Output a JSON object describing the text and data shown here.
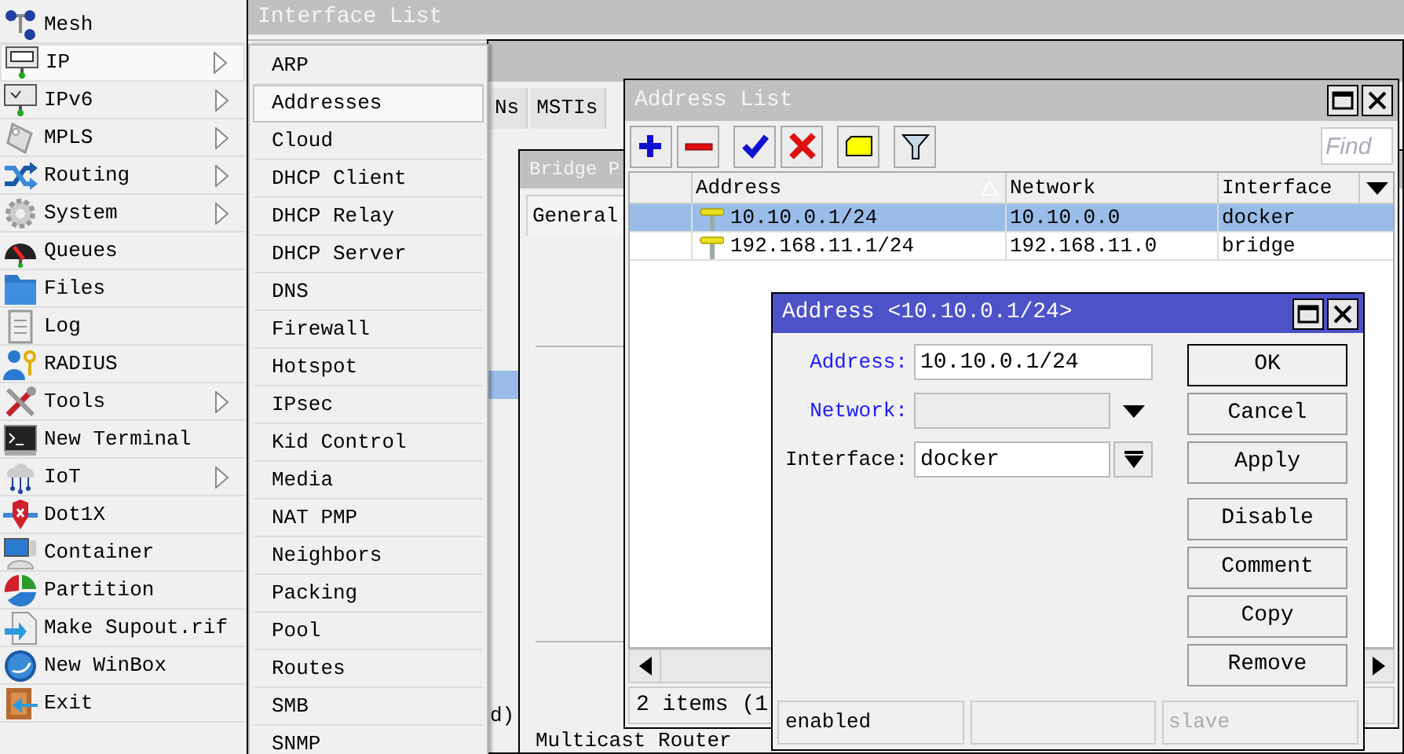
{
  "main_menu": {
    "items": [
      {
        "label": "Mesh",
        "has_submenu": false,
        "selected": false
      },
      {
        "label": "IP",
        "has_submenu": true,
        "selected": true
      },
      {
        "label": "IPv6",
        "has_submenu": true,
        "selected": false
      },
      {
        "label": "MPLS",
        "has_submenu": true,
        "selected": false
      },
      {
        "label": "Routing",
        "has_submenu": true,
        "selected": false
      },
      {
        "label": "System",
        "has_submenu": true,
        "selected": false
      },
      {
        "label": "Queues",
        "has_submenu": false,
        "selected": false
      },
      {
        "label": "Files",
        "has_submenu": false,
        "selected": false
      },
      {
        "label": "Log",
        "has_submenu": false,
        "selected": false
      },
      {
        "label": "RADIUS",
        "has_submenu": false,
        "selected": false
      },
      {
        "label": "Tools",
        "has_submenu": true,
        "selected": false
      },
      {
        "label": "New Terminal",
        "has_submenu": false,
        "selected": false
      },
      {
        "label": "IoT",
        "has_submenu": true,
        "selected": false
      },
      {
        "label": "Dot1X",
        "has_submenu": false,
        "selected": false
      },
      {
        "label": "Container",
        "has_submenu": false,
        "selected": false
      },
      {
        "label": "Partition",
        "has_submenu": false,
        "selected": false
      },
      {
        "label": "Make Supout.rif",
        "has_submenu": false,
        "selected": false
      },
      {
        "label": "New WinBox",
        "has_submenu": false,
        "selected": false
      },
      {
        "label": "Exit",
        "has_submenu": false,
        "selected": false
      }
    ]
  },
  "ip_submenu": {
    "items": [
      {
        "label": "ARP",
        "selected": false
      },
      {
        "label": "Addresses",
        "selected": true
      },
      {
        "label": "Cloud",
        "selected": false
      },
      {
        "label": "DHCP Client",
        "selected": false
      },
      {
        "label": "DHCP Relay",
        "selected": false
      },
      {
        "label": "DHCP Server",
        "selected": false
      },
      {
        "label": "DNS",
        "selected": false
      },
      {
        "label": "Firewall",
        "selected": false
      },
      {
        "label": "Hotspot",
        "selected": false
      },
      {
        "label": "IPsec",
        "selected": false
      },
      {
        "label": "Kid Control",
        "selected": false
      },
      {
        "label": "Media",
        "selected": false
      },
      {
        "label": "NAT PMP",
        "selected": false
      },
      {
        "label": "Neighbors",
        "selected": false
      },
      {
        "label": "Packing",
        "selected": false
      },
      {
        "label": "Pool",
        "selected": false
      },
      {
        "label": "Routes",
        "selected": false
      },
      {
        "label": "SMB",
        "selected": false
      },
      {
        "label": "SNMP",
        "selected": false
      }
    ]
  },
  "interface_list": {
    "title": "Interface List"
  },
  "bridge_window": {
    "tabs": [
      {
        "label": "Ns",
        "selected": false
      },
      {
        "label": "MSTIs",
        "selected": false
      }
    ],
    "status_fragment": "d)"
  },
  "bridge_port_window": {
    "title": "Bridge P",
    "tabs": [
      {
        "label": "General",
        "selected": true
      }
    ],
    "field_label": "Multicast Router"
  },
  "address_list": {
    "title": "Address List",
    "find_placeholder": "Find",
    "columns": [
      {
        "label": "Address",
        "sorted": true
      },
      {
        "label": "Network",
        "sorted": false
      },
      {
        "label": "Interface",
        "sorted": false
      }
    ],
    "rows": [
      {
        "address": "10.10.0.1/24",
        "network": "10.10.0.0",
        "interface": "docker",
        "selected": true
      },
      {
        "address": "192.168.11.1/24",
        "network": "192.168.11.0",
        "interface": "bridge",
        "selected": false
      }
    ],
    "status": "2 items (1"
  },
  "address_dialog": {
    "title": "Address <10.10.0.1/24>",
    "fields": [
      {
        "label": "Address:",
        "kind": "text",
        "value": "10.10.0.1/24",
        "highlighted": true
      },
      {
        "label": "Network:",
        "kind": "dropdown",
        "disabled": true,
        "highlighted": true
      },
      {
        "label": "Interface:",
        "kind": "combo",
        "value": "docker",
        "highlighted": false
      }
    ],
    "button_groups": [
      [
        {
          "label": "OK",
          "default": true
        },
        {
          "label": "Cancel",
          "default": false
        },
        {
          "label": "Apply",
          "default": false
        }
      ],
      [
        {
          "label": "Disable",
          "default": false
        },
        {
          "label": "Comment",
          "default": false
        },
        {
          "label": "Copy",
          "default": false
        },
        {
          "label": "Remove",
          "default": false
        }
      ]
    ],
    "status_bar": {
      "state": "enabled",
      "role": "slave"
    }
  }
}
